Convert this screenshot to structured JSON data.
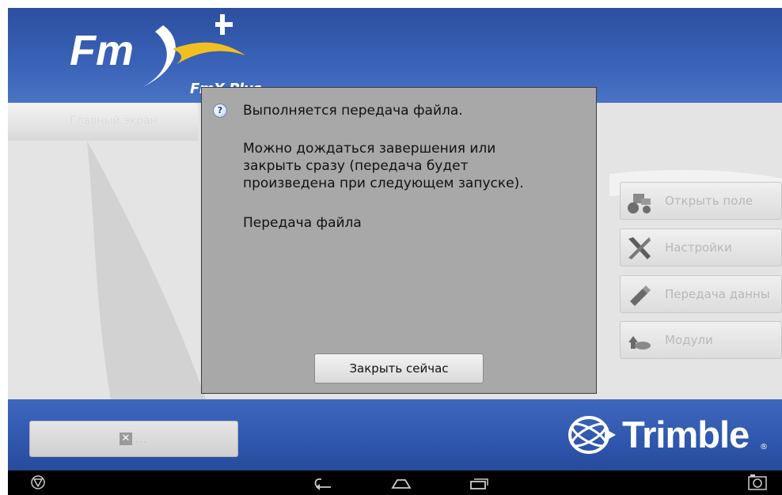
{
  "app": {
    "logo_main": "Fm",
    "logo_sub": "FmX Plus",
    "tab_main": "Главный экран"
  },
  "side_buttons": [
    {
      "label": "Открыть поле",
      "icon": "tractor-icon"
    },
    {
      "label": "Настройки",
      "icon": "tools-icon"
    },
    {
      "label": "Передача данны",
      "icon": "usb-stick-icon"
    },
    {
      "label": "Модули",
      "icon": "modules-icon"
    }
  ],
  "footer": {
    "quit_dots": "...",
    "brand": "Trimble",
    "brand_reg": "®"
  },
  "dialog": {
    "line1": "Выполняется передача файла.",
    "line2": "Можно дождаться завершения или",
    "line3": "закрыть сразу (передача будет",
    "line4": "произведена при следующем запуске).",
    "line5": "Передача файла",
    "close_label": "Закрыть сейчас"
  },
  "navbar": {
    "icons": [
      "shield-logo-icon",
      "back-icon",
      "home-icon",
      "recents-icon",
      "screenshot-icon"
    ]
  }
}
